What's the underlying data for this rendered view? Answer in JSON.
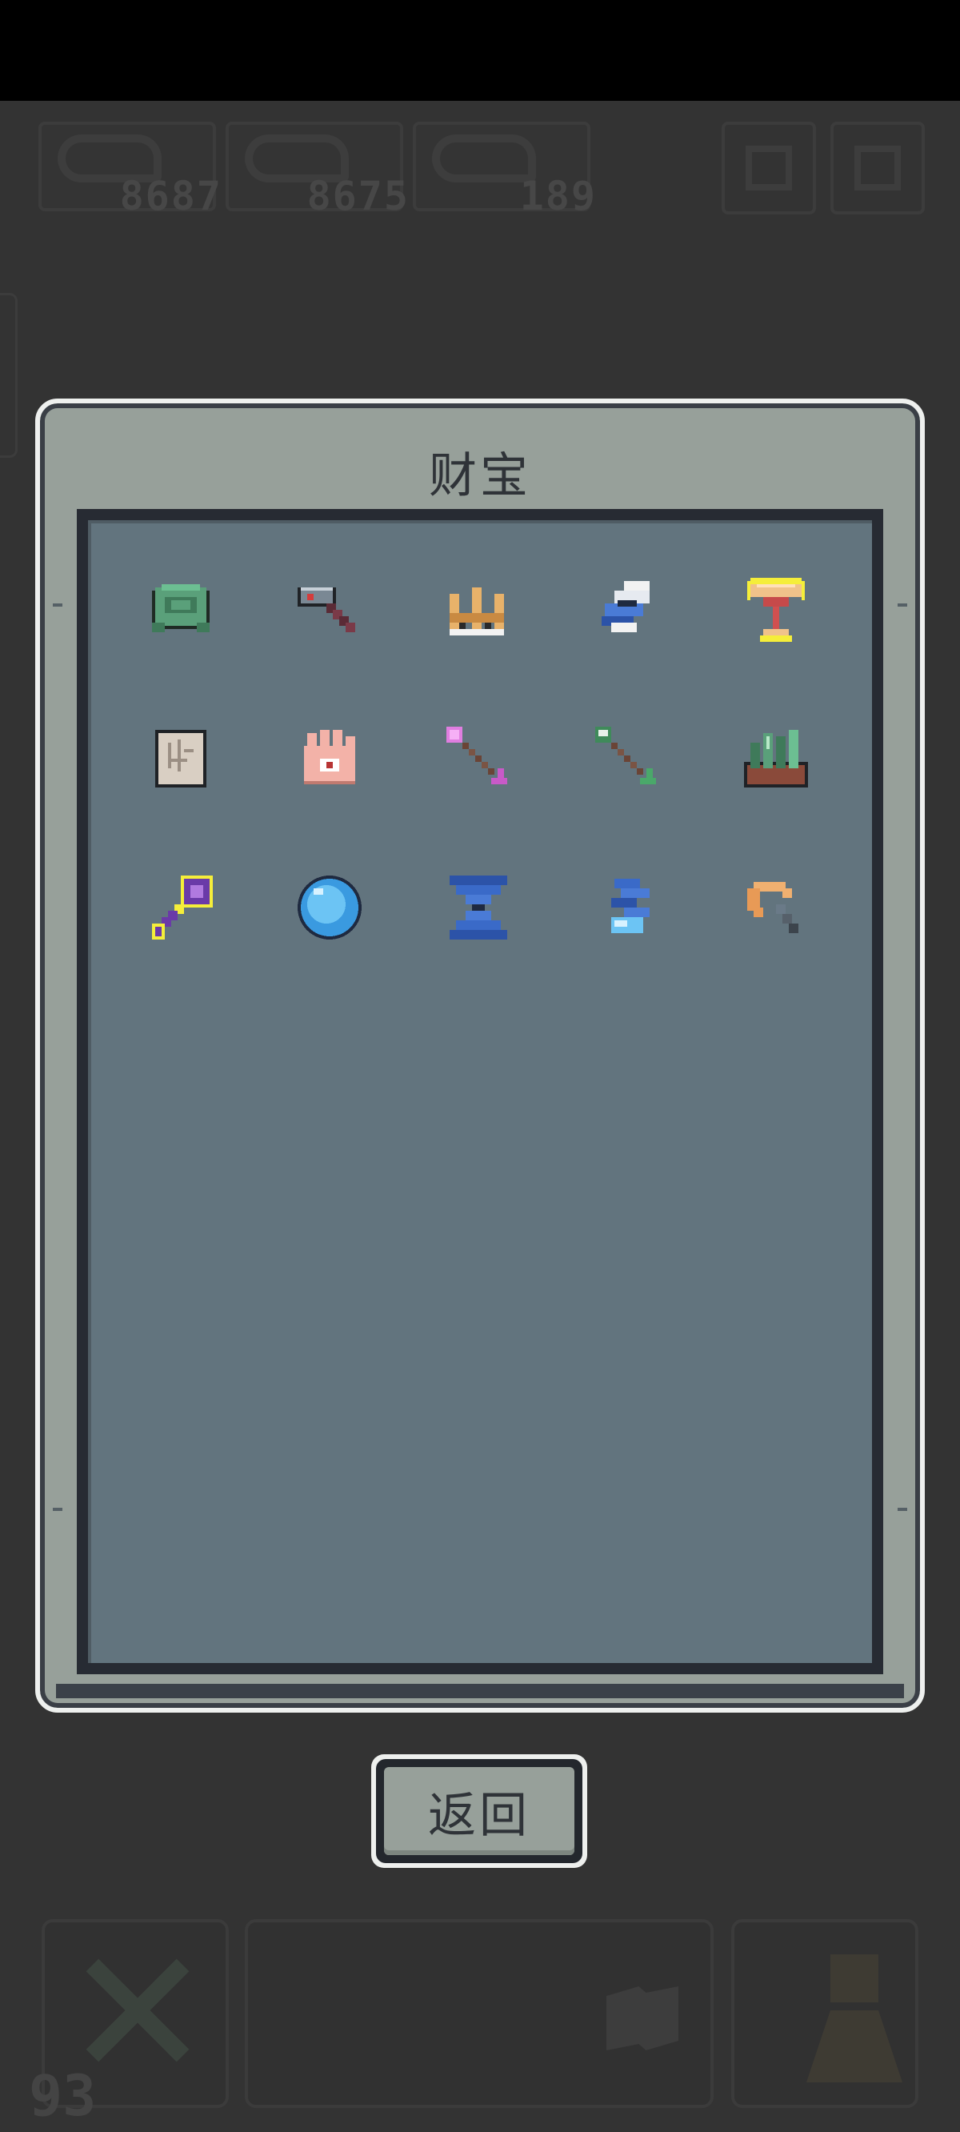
{
  "hud": {
    "stats": [
      {
        "value": "8687",
        "icon": "resource-icon"
      },
      {
        "value": "8675",
        "icon": "resource-icon"
      },
      {
        "value": "189",
        "icon": "resource-icon"
      }
    ]
  },
  "bottom_bar": {
    "slot_number": "93"
  },
  "modal": {
    "title": "财宝",
    "items": [
      {
        "name": "turtle-shell-icon"
      },
      {
        "name": "hammer-icon"
      },
      {
        "name": "crown-icon"
      },
      {
        "name": "feather-icon"
      },
      {
        "name": "goblet-icon",
        "highlighted": true
      },
      {
        "name": "scroll-map-icon"
      },
      {
        "name": "eye-hand-icon"
      },
      {
        "name": "pink-arrow-icon"
      },
      {
        "name": "green-arrow-icon"
      },
      {
        "name": "crystal-rock-icon"
      },
      {
        "name": "purple-key-icon",
        "highlighted": true
      },
      {
        "name": "blue-orb-icon"
      },
      {
        "name": "hourglass-icon"
      },
      {
        "name": "blue-flame-icon"
      },
      {
        "name": "shrimp-icon"
      }
    ]
  },
  "buttons": {
    "back_label": "返回"
  },
  "colors": {
    "background": "#333333",
    "panel": "#97a09a",
    "inner_panel": "#62747e",
    "highlight": "#f5ee3a"
  }
}
